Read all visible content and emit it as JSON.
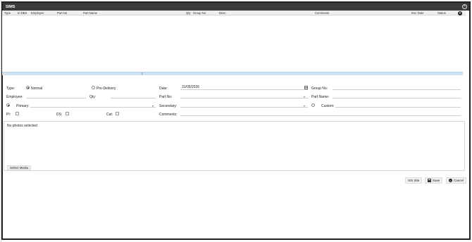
{
  "window": {
    "title": "SIMS",
    "close_icon": "close-icon"
  },
  "grid": {
    "columns": [
      "Type",
      "In DBS",
      "Employee",
      "Part No",
      "Part Name",
      "Qty",
      "Group No",
      "Desc",
      "Comments",
      "Doc Date",
      "Status"
    ],
    "add_icon": "plus-circle-icon",
    "rows": []
  },
  "form": {
    "type_label": "Type:",
    "type_normal": "Normal",
    "type_predelivery": "Pre-Delivery",
    "date_label": "Date:",
    "date_value": "31/05/2026",
    "group_no_label": "Group No:",
    "employee_label": "Employee:",
    "qty_label": "Qty:",
    "part_no_label": "Part No:",
    "part_name_label": "Part Name:",
    "primary_label": "Primary:",
    "secondary_label": "Secondary:",
    "custom_label": "Custom:",
    "pi_label": "PI:",
    "ds_label": "DS:",
    "cat_label": "Cat:",
    "comments_label": "Comments:"
  },
  "photos": {
    "empty_message": "No photos selected",
    "select_media_label": "Select Media"
  },
  "footer": {
    "sis_site_label": "SIS Site",
    "save_label": "Save",
    "cancel_label": "Cancel"
  }
}
